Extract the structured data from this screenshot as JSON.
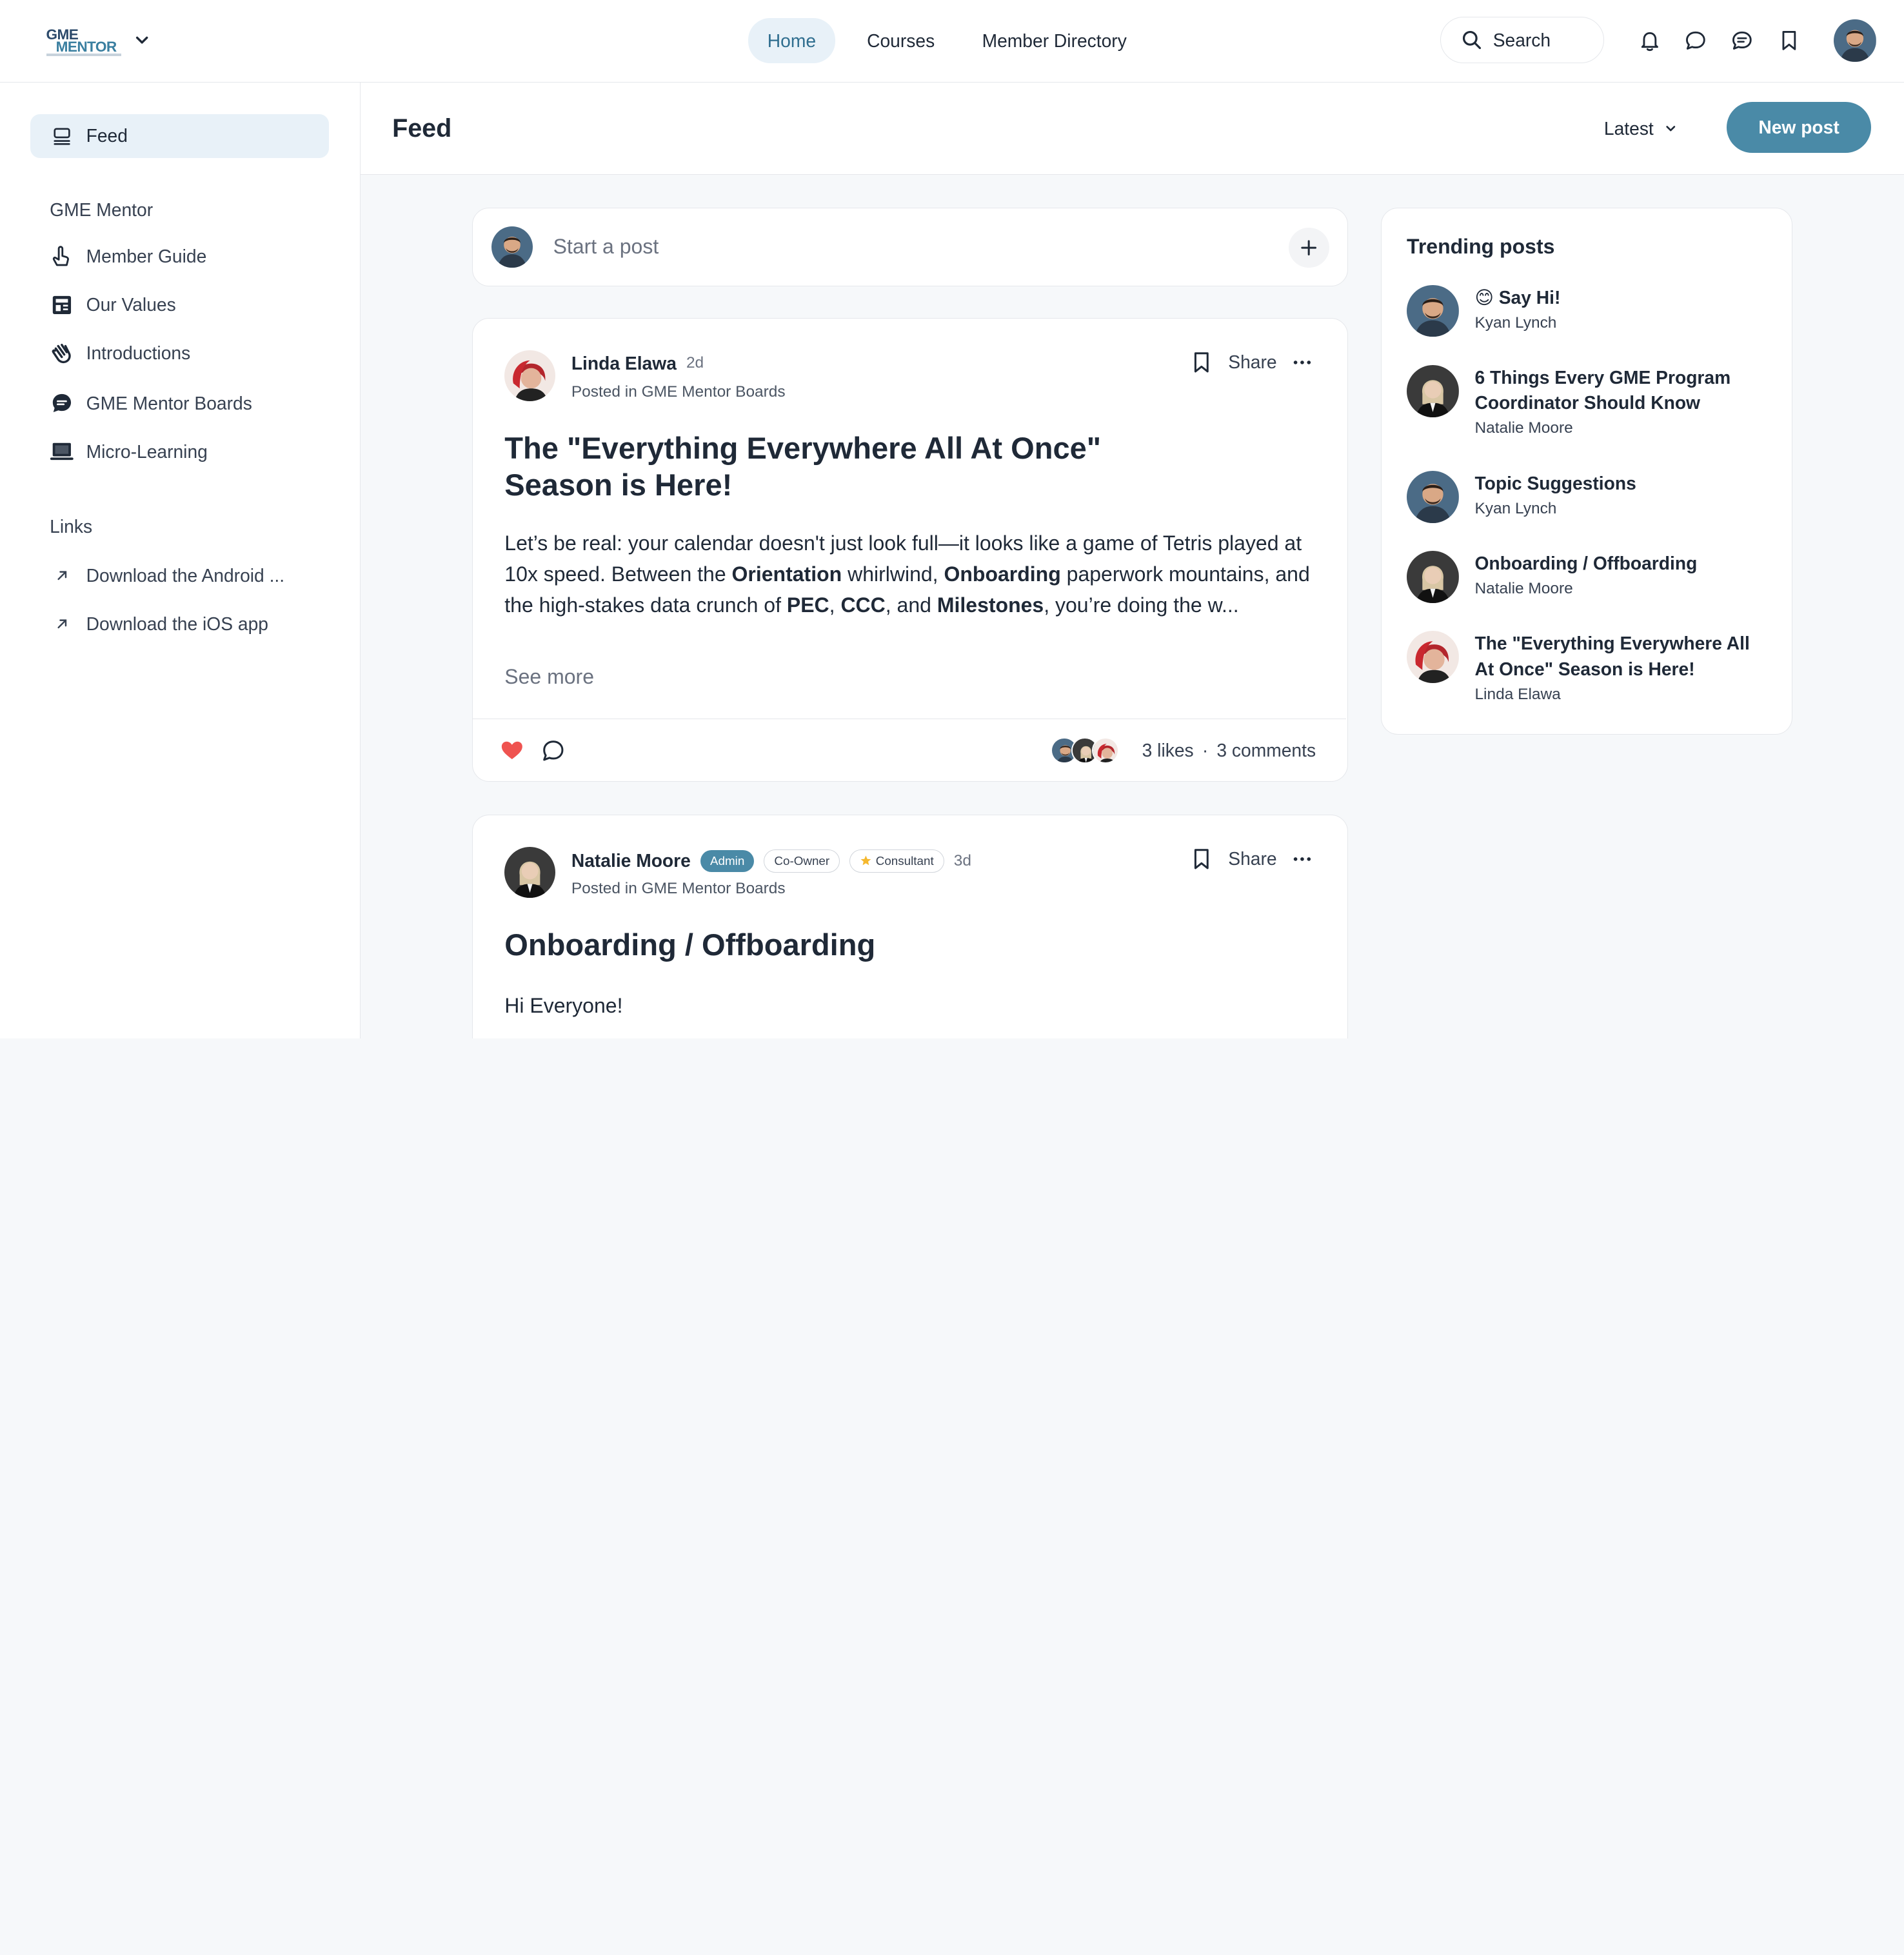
{
  "header": {
    "logo_line1": "GME",
    "logo_line2": "MENTOR",
    "nav": [
      {
        "label": "Home",
        "active": true
      },
      {
        "label": "Courses",
        "active": false
      },
      {
        "label": "Member Directory",
        "active": false
      }
    ],
    "search_label": "Search"
  },
  "sidebar": {
    "feed_label": "Feed",
    "group_heading": "GME Mentor",
    "items": [
      {
        "label": "Member Guide",
        "icon": "hand-pointer-icon"
      },
      {
        "label": "Our Values",
        "icon": "newspaper-icon"
      },
      {
        "label": "Introductions",
        "icon": "wave-icon"
      },
      {
        "label": "GME Mentor Boards",
        "icon": "chat-bubble-icon"
      },
      {
        "label": "Micro-Learning",
        "icon": "laptop-icon"
      }
    ],
    "links_heading": "Links",
    "links": [
      {
        "label": "Download the Android ..."
      },
      {
        "label": "Download the iOS app"
      }
    ]
  },
  "main": {
    "title": "Feed",
    "sort_label": "Latest",
    "new_post_label": "New post",
    "composer_placeholder": "Start a post"
  },
  "posts": [
    {
      "author": "Linda Elawa",
      "time": "2d",
      "posted_in": "Posted in GME Mentor Boards",
      "share_label": "Share",
      "title_line1": "The \"Everything Everywhere All At Once\"",
      "title_line2": "Season is Here!",
      "body": {
        "t1": "Let’s be real: your calendar doesn't just look full—it looks like a game of Tetris played at 10x speed. Between the ",
        "b1": "Orientation",
        "t2": " whirlwind, ",
        "b2": "Onboarding",
        "t3": " paperwork mountains, and the high-stakes data crunch of ",
        "b3": "PEC",
        "t4": ", ",
        "b4": "CCC",
        "t5": ", and ",
        "b5": "Milestones",
        "t6": ", you’re doing the w..."
      },
      "see_more": "See more",
      "likes": "3 likes",
      "separator": "·",
      "comments": "3 comments"
    },
    {
      "author": "Natalie Moore",
      "badges": [
        "Admin",
        "Co-Owner",
        "Consultant"
      ],
      "time": "3d",
      "posted_in": "Posted in GME Mentor Boards",
      "share_label": "Share",
      "title": "Onboarding / Offboarding",
      "body_start": "Hi Everyone!"
    }
  ],
  "trending": {
    "title": "Trending posts",
    "items": [
      {
        "title": "Say Hi!",
        "emoji": "😊",
        "author": "Kyan Lynch"
      },
      {
        "title_line1": "6 Things Every GME Program",
        "title_line2": "Coordinator Should Know",
        "author": "Natalie Moore"
      },
      {
        "title": "Topic Suggestions",
        "author": "Kyan Lynch"
      },
      {
        "title": "Onboarding / Offboarding",
        "author": "Natalie Moore"
      },
      {
        "title_line1": "The \"Everything Everywhere All",
        "title_line2": "At Once\" Season is Here!",
        "author": "Linda Elawa"
      }
    ]
  },
  "colors": {
    "accent": "#4a8aa7",
    "active_bg": "#e8f1f8",
    "like_red": "#ef5350"
  }
}
